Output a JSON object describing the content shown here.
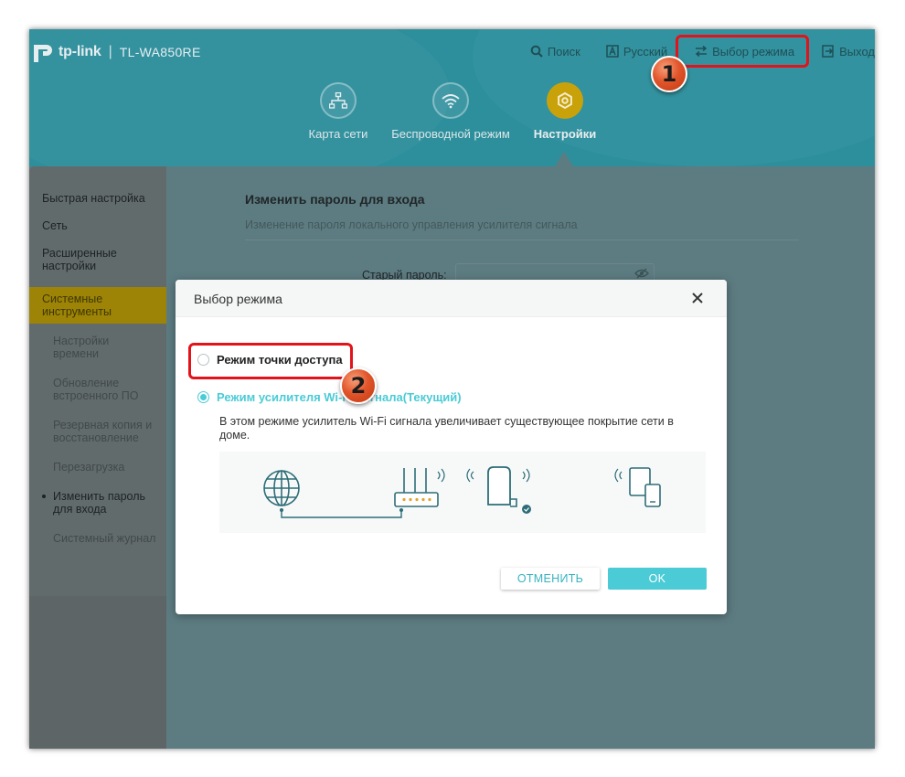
{
  "header": {
    "brand": "tp-link",
    "separator": "|",
    "model": "TL-WA850RE",
    "top_nav": {
      "search": "Поиск",
      "language": "Русский",
      "mode_select": "Выбор режима",
      "logout": "Выход"
    },
    "main_nav": [
      {
        "label": "Карта сети",
        "icon": "network-map-icon"
      },
      {
        "label": "Беспроводной режим",
        "icon": "wifi-icon"
      },
      {
        "label": "Настройки",
        "icon": "gear-icon",
        "active": true
      }
    ]
  },
  "sidebar": {
    "items": [
      {
        "label": "Быстрая настройка"
      },
      {
        "label": "Сеть"
      },
      {
        "label": "Расширенные настройки"
      },
      {
        "label": "Системные инструменты",
        "active": true
      }
    ],
    "subitems": [
      {
        "label": "Настройки времени"
      },
      {
        "label": "Обновление встроенного ПО"
      },
      {
        "label": "Резервная копия и восстановление"
      },
      {
        "label": "Перезагрузка"
      },
      {
        "label": "Изменить пароль для входа",
        "current": true
      },
      {
        "label": "Системный журнал"
      }
    ]
  },
  "content": {
    "title": "Изменить пароль для входа",
    "subtitle": "Изменение пароля локального управления усилителя сигнала",
    "old_password_label": "Старый пароль:",
    "old_password_value": ""
  },
  "modal": {
    "title": "Выбор режима",
    "options": [
      {
        "label": "Режим точки доступа",
        "checked": false
      },
      {
        "label": "Режим усилителя Wi-Fi сигнала(Текущий)",
        "checked": true
      }
    ],
    "description": "В этом режиме усилитель Wi-Fi сигнала увеличивает существующее покрытие сети в доме.",
    "cancel_label": "ОТМЕНИТЬ",
    "ok_label": "OK"
  },
  "annotations": {
    "step1": "1",
    "step2": "2"
  },
  "colors": {
    "accent": "#4acbd6",
    "header_teal": "#2d8f9c",
    "active_gold": "#c9a20a",
    "highlight_red": "#e3121b"
  }
}
